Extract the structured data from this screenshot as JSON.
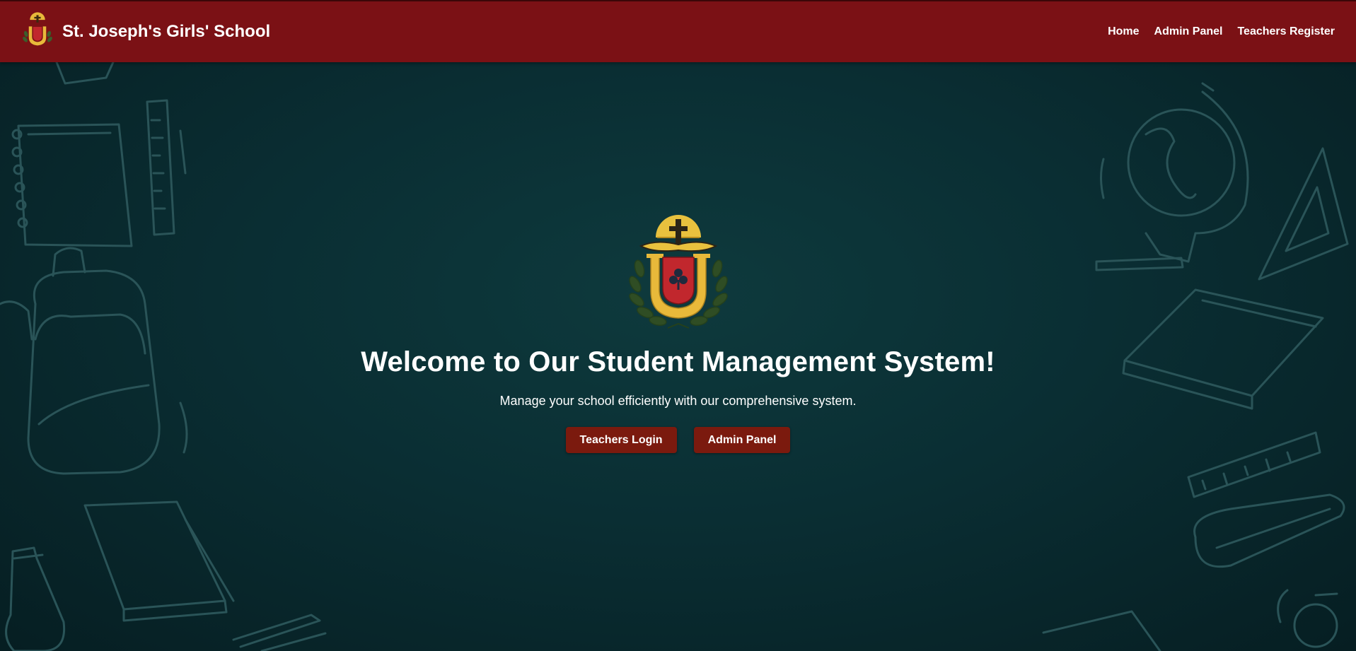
{
  "navbar": {
    "brand_name": "St. Joseph's Girls' School",
    "logo_icon": "school-crest-icon",
    "links": [
      {
        "label": "Home"
      },
      {
        "label": "Admin Panel"
      },
      {
        "label": "Teachers Register"
      }
    ]
  },
  "hero": {
    "crest_icon": "school-crest-icon",
    "title": "Welcome to Our Student Management System!",
    "subtitle": "Manage your school efficiently with our comprehensive system.",
    "buttons": [
      {
        "label": "Teachers Login"
      },
      {
        "label": "Admin Panel"
      }
    ]
  },
  "background": {
    "doodle_icons": [
      "notebook-icon",
      "ruler-icon",
      "backpack-icon",
      "book-icon",
      "pencil-icon",
      "globe-icon",
      "set-square-icon",
      "pencil-case-icon"
    ]
  },
  "colors": {
    "navbar": "#7b1115",
    "button": "#7b1a0e",
    "background": "#0a2e33",
    "crest_gold": "#e8b93a",
    "crest_red": "#c1272d"
  }
}
